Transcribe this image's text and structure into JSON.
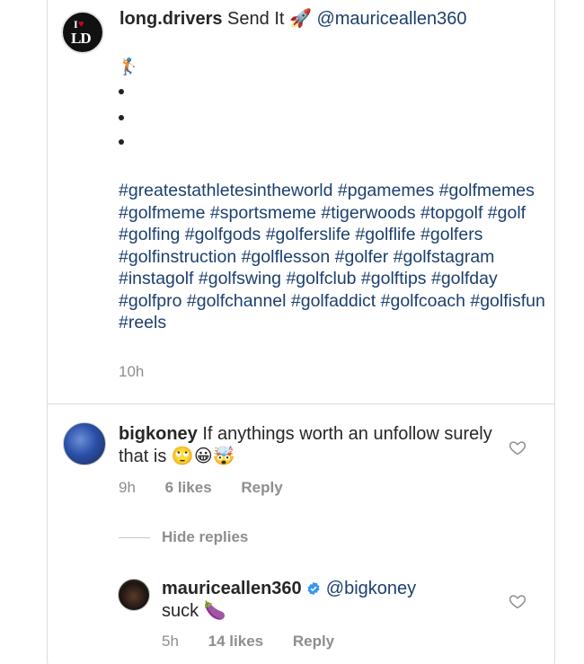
{
  "post": {
    "username": "long.drivers",
    "caption_title": "Send It 🚀",
    "mention": "@mauriceallen360",
    "golfer_emoji": "🏌",
    "hashtags": "#greatestathletesintheworld #pgamemes #golfmemes #golfmeme #sportsmeme #tigerwoods #topgolf #golf #golfing #golfgods #golferslife #golflife #golfers #golfinstruction #golflesson #golfer #golfstagram #instagolf #golfswing #golfclub #golftips #golfday #golfpro #golfchannel #golfaddict #golfcoach #golfisfun #reels",
    "time": "10h",
    "avatar_logo": "I ♥ LD"
  },
  "comments": [
    {
      "username": "bigkoney",
      "text": "If anythings worth an unfollow surely that is 🙄😀🤯",
      "time": "9h",
      "likes": "6 likes",
      "reply_label": "Reply"
    }
  ],
  "hide_replies_label": "Hide replies",
  "reply": {
    "username": "mauriceallen360",
    "mention": "@bigkoney",
    "text": "suck 🍆",
    "time": "5h",
    "likes": "14 likes",
    "reply_label": "Reply"
  },
  "colors": {
    "link": "#1c3f6e",
    "muted": "#8e8e8e",
    "verified": "#3897f0"
  }
}
